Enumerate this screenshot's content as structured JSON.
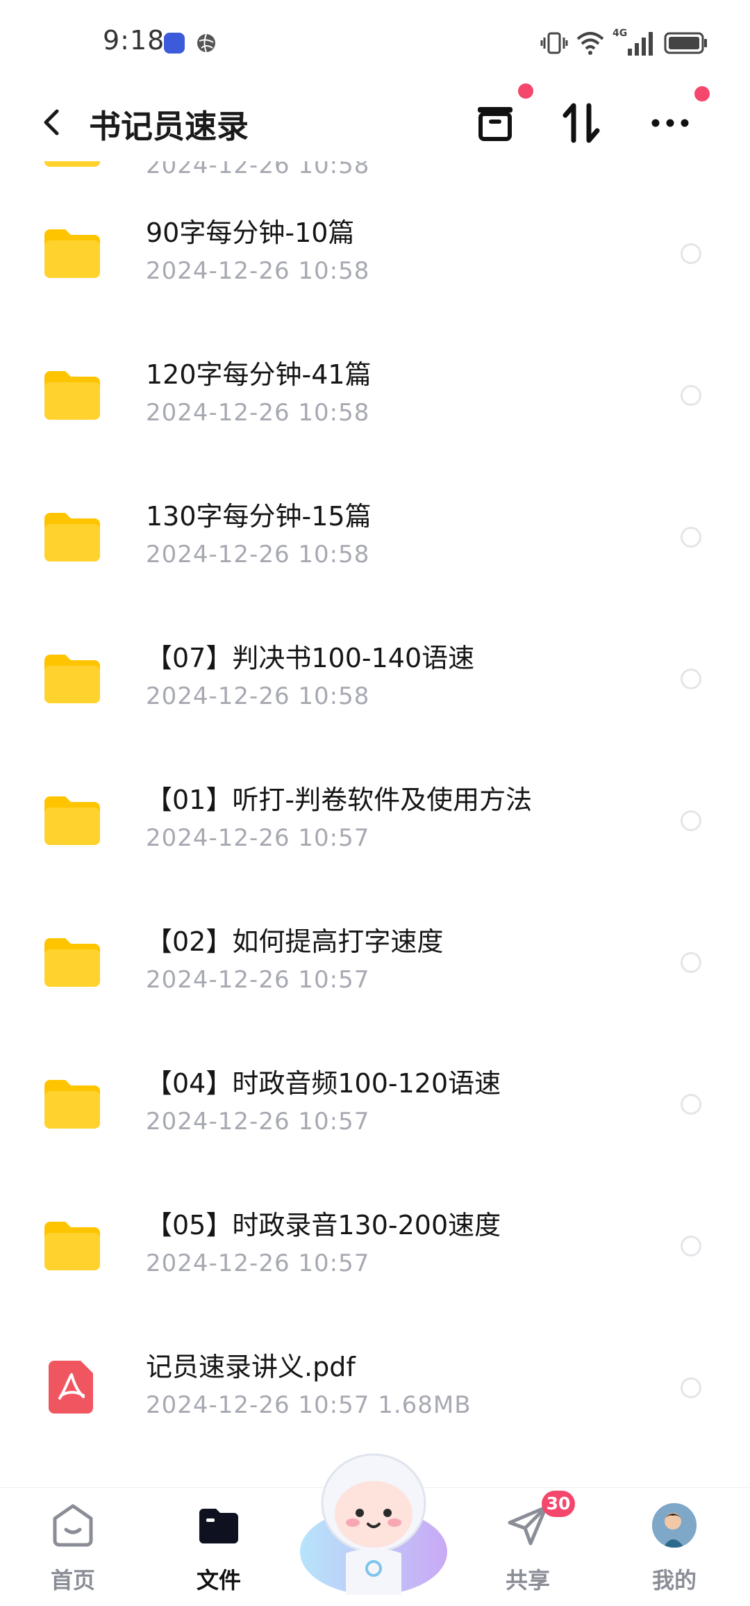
{
  "status_bar": {
    "time": "9:18",
    "network": "4G"
  },
  "header": {
    "title": "书记员速录"
  },
  "files": [
    {
      "type": "folder",
      "name": "",
      "meta": "2024-12-26  10:58"
    },
    {
      "type": "folder",
      "name": "90字每分钟-10篇",
      "meta": "2024-12-26  10:58"
    },
    {
      "type": "folder",
      "name": "120字每分钟-41篇",
      "meta": "2024-12-26  10:58"
    },
    {
      "type": "folder",
      "name": "130字每分钟-15篇",
      "meta": "2024-12-26  10:58"
    },
    {
      "type": "folder",
      "name": "【07】判决书100-140语速",
      "meta": "2024-12-26  10:58"
    },
    {
      "type": "folder",
      "name": "【01】听打-判卷软件及使用方法",
      "meta": "2024-12-26  10:57"
    },
    {
      "type": "folder",
      "name": "【02】如何提高打字速度",
      "meta": "2024-12-26  10:57"
    },
    {
      "type": "folder",
      "name": "【04】时政音频100-120语速",
      "meta": "2024-12-26  10:57"
    },
    {
      "type": "folder",
      "name": "【05】时政录音130-200速度",
      "meta": "2024-12-26  10:57"
    },
    {
      "type": "pdf",
      "name": "记员速录讲义.pdf",
      "meta": "2024-12-26  10:57  1.68MB"
    }
  ],
  "bottom_nav": {
    "home": "首页",
    "files": "文件",
    "share": "共享",
    "share_badge": "30",
    "me": "我的"
  },
  "colors": {
    "accent_red": "#f5466b",
    "folder_yellow": "#ffd22e",
    "pdf_red": "#f0565f",
    "meta_gray": "#a7a9b2"
  },
  "icons": {
    "back": "chevron-left-icon",
    "archive": "archive-box-icon",
    "sort": "sort-arrows-icon",
    "more": "more-dots-icon",
    "home": "home-face-icon",
    "files": "folder-tab-icon",
    "share": "paper-plane-icon",
    "mascot": "mascot-icon"
  }
}
